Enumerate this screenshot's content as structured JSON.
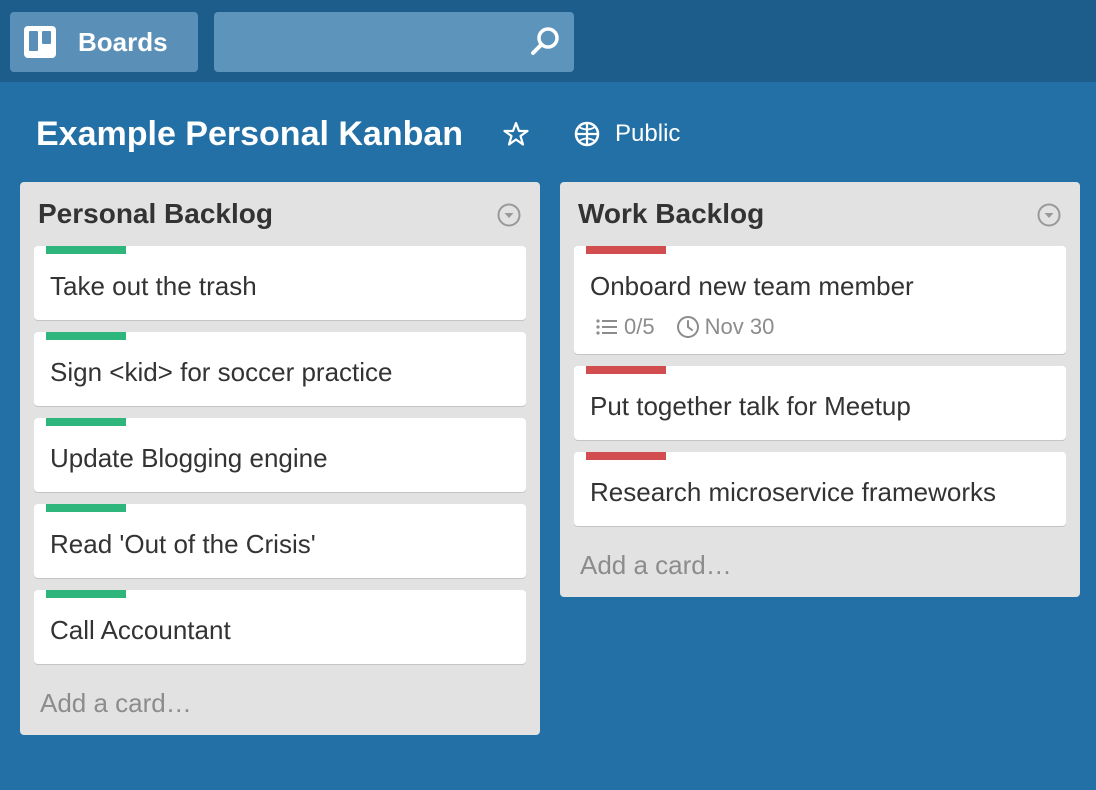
{
  "topbar": {
    "boards_label": "Boards",
    "search": {
      "value": "",
      "placeholder": ""
    }
  },
  "board": {
    "title": "Example Personal Kanban",
    "visibility": "Public"
  },
  "colors": {
    "green_label": "#2eb67d",
    "red_label": "#d24d4f",
    "background": "#2370a6"
  },
  "lists": [
    {
      "title": "Personal Backlog",
      "add_card": "Add a card…",
      "cards": [
        {
          "text": "Take out the trash",
          "label": "green"
        },
        {
          "text": "Sign <kid> for soccer practice",
          "label": "green"
        },
        {
          "text": "Update Blogging engine",
          "label": "green"
        },
        {
          "text": "Read 'Out of the Crisis'",
          "label": "green"
        },
        {
          "text": "Call Accountant",
          "label": "green"
        }
      ]
    },
    {
      "title": "Work Backlog",
      "add_card": "Add a card…",
      "cards": [
        {
          "text": "Onboard new team member",
          "label": "red",
          "checklist": "0/5",
          "due": "Nov 30"
        },
        {
          "text": "Put together talk for Meetup",
          "label": "red"
        },
        {
          "text": "Research microservice frameworks",
          "label": "red"
        }
      ]
    }
  ]
}
